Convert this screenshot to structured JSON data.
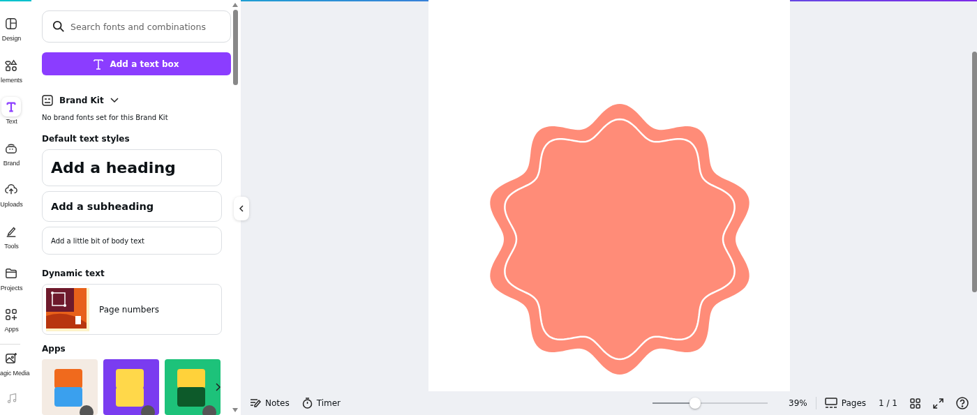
{
  "rail": [
    {
      "label": "Design",
      "selected": false
    },
    {
      "label": "lements",
      "selected": false
    },
    {
      "label": "Text",
      "selected": true
    },
    {
      "label": "Brand",
      "selected": false
    },
    {
      "label": "Uploads",
      "selected": false
    },
    {
      "label": "Tools",
      "selected": false
    },
    {
      "label": "Projects",
      "selected": false
    },
    {
      "label": "Apps",
      "selected": false
    },
    {
      "label": "agic Media",
      "selected": false
    }
  ],
  "panel": {
    "search": {
      "placeholder": "Search fonts and combinations"
    },
    "add_button": "Add a text box",
    "brand_kit": {
      "title": "Brand Kit",
      "note": "No brand fonts set for this Brand Kit"
    },
    "default_styles": {
      "title": "Default text styles",
      "items": [
        {
          "kind": "heading",
          "label": "Add a heading"
        },
        {
          "kind": "subheading",
          "label": "Add a subheading"
        },
        {
          "kind": "body",
          "label": "Add a little bit of body text"
        }
      ]
    },
    "dynamic": {
      "title": "Dynamic text",
      "items": [
        {
          "label": "Page numbers",
          "kind": "picture"
        }
      ]
    },
    "apps": {
      "title": "Apps"
    }
  },
  "bottom_bar": {
    "notes": "Notes",
    "timer": "Timer",
    "zoom": {
      "level": 0.37
    },
    "zoom_reading": "39%",
    "pages": "Pages",
    "page_count": "1 / 1"
  }
}
